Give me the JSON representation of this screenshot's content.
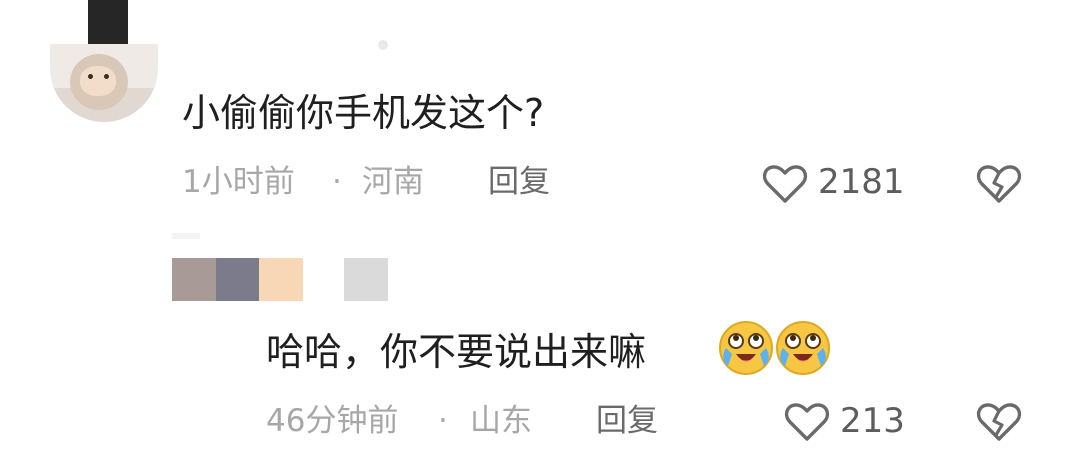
{
  "comments": [
    {
      "text": "小偷偷你手机发这个?",
      "time": "1小时前",
      "location": "河南",
      "reply_label": "回复",
      "likes": "2181"
    },
    {
      "text": "哈哈，你不要说出来嘛",
      "time": "46分钟前",
      "location": "山东",
      "reply_label": "回复",
      "likes": "213",
      "emoji": [
        "crying-laughing-emoji",
        "crying-laughing-emoji"
      ]
    }
  ],
  "separator": "·",
  "colors": {
    "text": "#1f1f1f",
    "meta": "#a7a7a7",
    "icon": "#6a6a6a",
    "censor_swatches": [
      "#a89a97",
      "#7c7b8b",
      "#f8d7b7",
      "#dadada"
    ]
  },
  "icons": [
    "heart-outline-icon",
    "broken-heart-icon"
  ]
}
